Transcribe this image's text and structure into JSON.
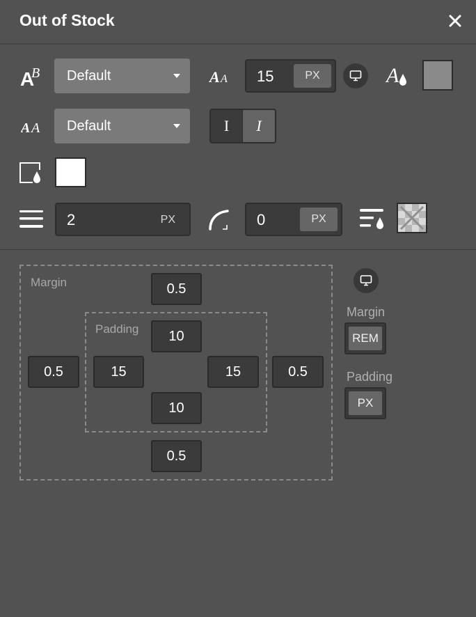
{
  "header": {
    "title": "Out of Stock",
    "close_icon": "close-icon"
  },
  "typography": {
    "font_family_value": "Default",
    "font_size_value": "15",
    "font_size_unit": "PX",
    "font_weight_value": "Default",
    "style_normal_label": "I",
    "style_italic_label": "I",
    "text_color": "#8a8a8a"
  },
  "background": {
    "color": "#ffffff"
  },
  "border": {
    "width_value": "2",
    "width_unit": "PX",
    "radius_value": "0",
    "radius_unit": "PX",
    "border_color": "transparent"
  },
  "spacing": {
    "margin_label": "Margin",
    "padding_label": "Padding",
    "margin": {
      "top": "0.5",
      "right": "0.5",
      "bottom": "0.5",
      "left": "0.5"
    },
    "padding": {
      "top": "10",
      "right": "15",
      "bottom": "10",
      "left": "15"
    },
    "side_margin_label": "Margin",
    "side_margin_unit": "REM",
    "side_padding_label": "Padding",
    "side_padding_unit": "PX"
  }
}
